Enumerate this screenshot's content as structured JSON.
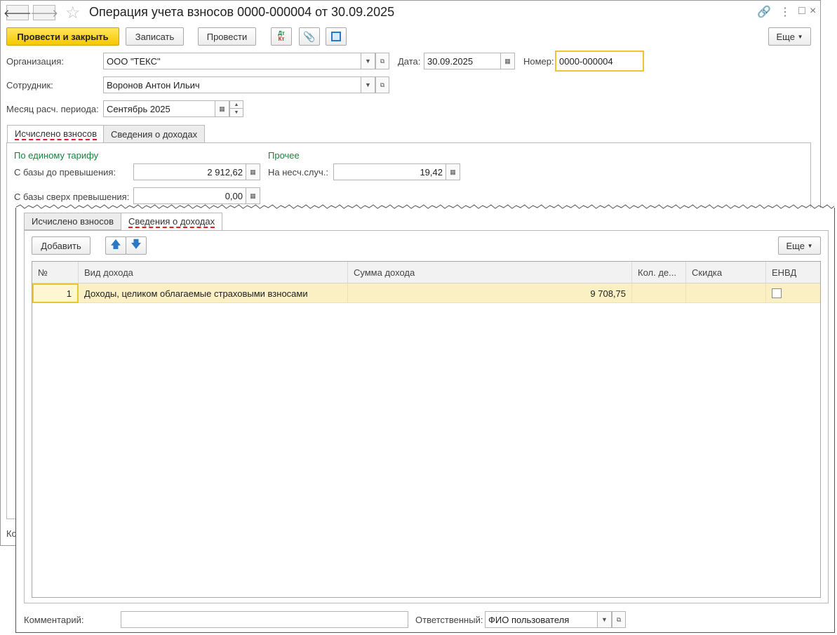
{
  "window": {
    "title": "Операция учета взносов 0000-000004 от 30.09.2025",
    "nav_back_icon": "arrow-left-icon",
    "nav_forward_icon": "arrow-right-icon"
  },
  "toolbar": {
    "post_close_label": "Провести и закрыть",
    "save_label": "Записать",
    "post_label": "Провести",
    "dtkt_dt": "Дт",
    "dtkt_kt": "Кт",
    "more_label": "Еще"
  },
  "form": {
    "org_label": "Организация:",
    "org_value": "ООО \"ТЕКС\"",
    "date_label": "Дата:",
    "date_value": "30.09.2025",
    "number_label": "Номер:",
    "number_value": "0000-000004",
    "employee_label": "Сотрудник:",
    "employee_value": "Воронов Антон Ильич",
    "month_label": "Месяц расч. периода:",
    "month_value": "Сентябрь 2025"
  },
  "tabs": {
    "calculated": "Исчислено взносов",
    "income": "Сведения о доходах"
  },
  "calc": {
    "single_tariff_header": "По единому тарифу",
    "other_header": "Прочее",
    "base_below_label": "С базы до превышения:",
    "base_below_value": "2 912,62",
    "base_above_label": "С базы сверх превышения:",
    "base_above_value": "0,00",
    "accident_label": "На несч.случ.:",
    "accident_value": "19,42"
  },
  "comment_cut": "Ко",
  "income": {
    "add_label": "Добавить",
    "more_label": "Еще",
    "columns": [
      "№",
      "Вид дохода",
      "Сумма дохода",
      "Кол. де...",
      "Скидка",
      "ЕНВД"
    ],
    "rows": [
      {
        "n": "1",
        "kind": "Доходы, целиком облагаемые страховыми взносами",
        "amount": "9 708,75",
        "count": "",
        "discount": "",
        "envd": false
      }
    ]
  },
  "footer": {
    "comment_label": "Комментарий:",
    "comment_value": "",
    "responsible_label": "Ответственный:",
    "responsible_value": "ФИО пользователя"
  },
  "colors": {
    "primary_button": "#f5c800",
    "group_header_green": "#17843c",
    "active_tab_underline": "#e31b1b",
    "selected_row": "#fbf0c4"
  }
}
